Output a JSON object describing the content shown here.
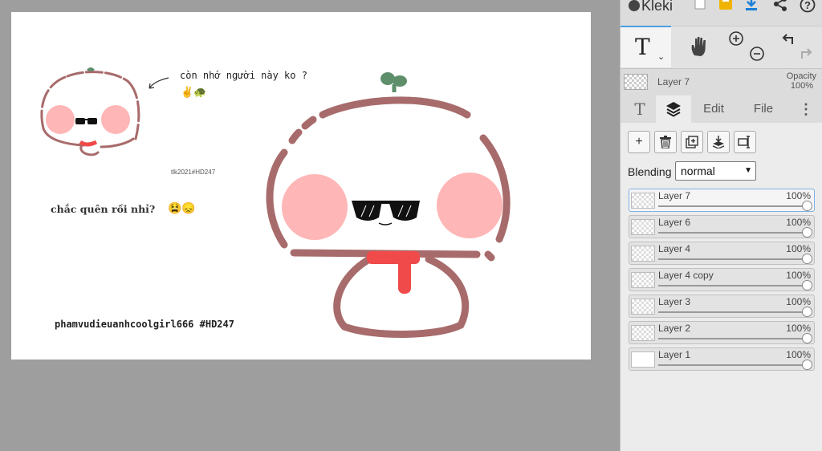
{
  "app": {
    "name": "Kleki"
  },
  "canvas": {
    "question_text": "còn nhớ người này ko ?",
    "emoji_line1": "✌🐢",
    "small_signature": "tlk2021#HD247",
    "forgot_text": "chắc quên rồi nhỉ?",
    "emoji_line2": "😫😞",
    "signature": "phamvudieuanhcoolgirl666 #HD247"
  },
  "tools": {
    "text_tool_glyph": "T",
    "text_tool_caret": "⌄",
    "hand_icon": "hand-icon",
    "zoom_in_icon": "zoom-in-icon",
    "zoom_out_icon": "zoom-out-icon",
    "undo_icon": "undo-icon",
    "redo_icon": "redo-icon"
  },
  "current_layer": {
    "name": "Layer 7",
    "opacity_label": "Opacity",
    "opacity_value": "100%"
  },
  "tabs": {
    "text_glyph": "T",
    "layers_icon": "layers-icon",
    "edit": "Edit",
    "file": "File",
    "more": "⋮"
  },
  "layer_buttons": {
    "add": "+",
    "delete_icon": "trash-icon",
    "duplicate_icon": "duplicate-icon",
    "merge_icon": "merge-down-icon",
    "rename_icon": "rename-icon"
  },
  "blending": {
    "label": "Blending",
    "value": "normal"
  },
  "layers": [
    {
      "name": "Layer 7",
      "opacity": "100%",
      "active": true
    },
    {
      "name": "Layer 6",
      "opacity": "100%",
      "active": false
    },
    {
      "name": "Layer 4",
      "opacity": "100%",
      "active": false
    },
    {
      "name": "Layer 4 copy",
      "opacity": "100%",
      "active": false
    },
    {
      "name": "Layer 3",
      "opacity": "100%",
      "active": false
    },
    {
      "name": "Layer 2",
      "opacity": "100%",
      "active": false
    },
    {
      "name": "Layer 1",
      "opacity": "100%",
      "active": false
    }
  ],
  "colors": {
    "outline": "#a86b6b",
    "blush": "#ffb6b6",
    "scarf": "#f04a4a",
    "sprout": "#5e8e6a",
    "accent": "#4a9fe0"
  }
}
